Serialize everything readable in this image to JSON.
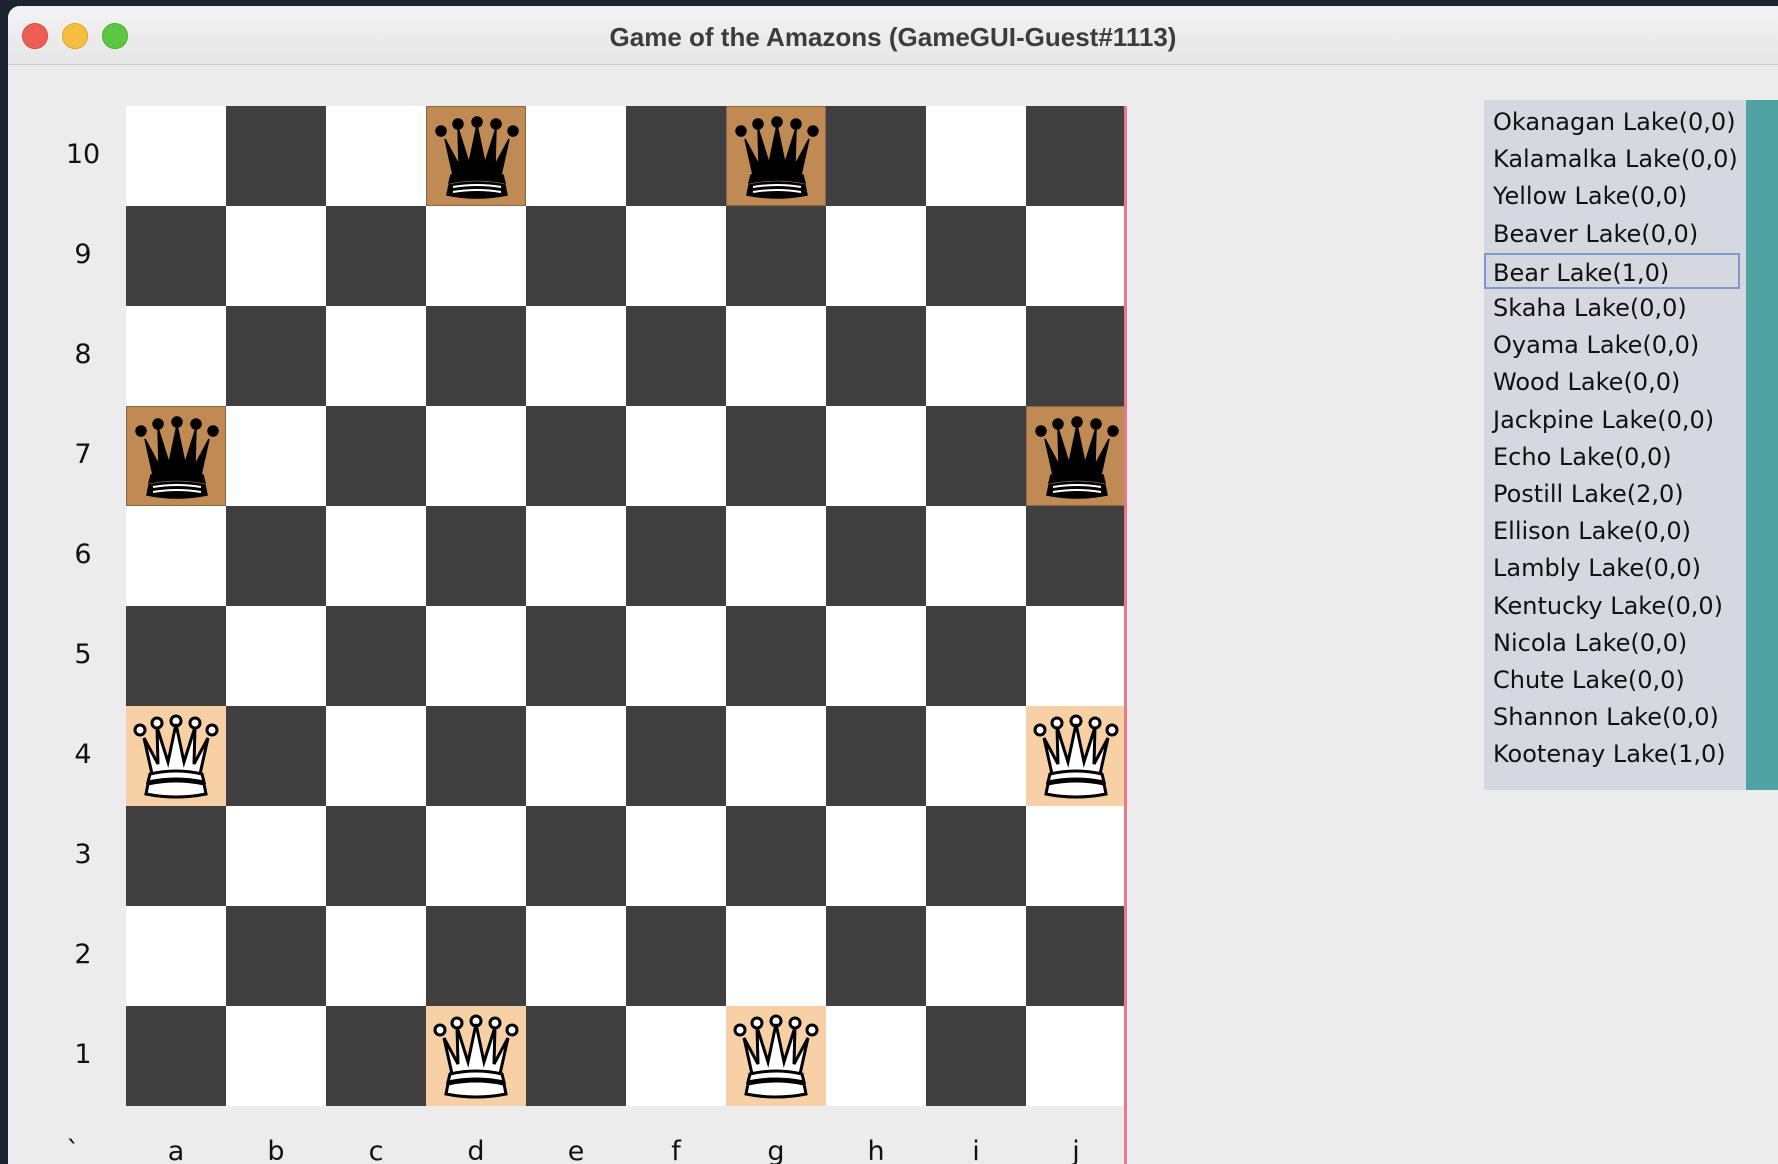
{
  "window": {
    "title": "Game of the Amazons (GameGUI-Guest#1113)"
  },
  "colors": {
    "light_square": "#ffffff",
    "dark_square": "#404040",
    "black_queen_square": "#c08a55",
    "white_queen_square": "#f7d0a5",
    "board_edge": "#e8788e",
    "list_bg": "#d5d8de",
    "scrollbar": "#4fa3a3"
  },
  "board": {
    "size": 10,
    "ranks": [
      "10",
      "9",
      "8",
      "7",
      "6",
      "5",
      "4",
      "3",
      "2",
      "1"
    ],
    "files": [
      "`",
      "a",
      "b",
      "c",
      "d",
      "e",
      "f",
      "g",
      "h",
      "i",
      "j"
    ],
    "pieces": [
      {
        "color": "black",
        "icon": "black-queen-icon",
        "square": "d10"
      },
      {
        "color": "black",
        "icon": "black-queen-icon",
        "square": "g10"
      },
      {
        "color": "black",
        "icon": "black-queen-icon",
        "square": "a7"
      },
      {
        "color": "black",
        "icon": "black-queen-icon",
        "square": "j7"
      },
      {
        "color": "white",
        "icon": "white-queen-icon",
        "square": "a4"
      },
      {
        "color": "white",
        "icon": "white-queen-icon",
        "square": "j4"
      },
      {
        "color": "white",
        "icon": "white-queen-icon",
        "square": "d1"
      },
      {
        "color": "white",
        "icon": "white-queen-icon",
        "square": "g1"
      }
    ]
  },
  "players": {
    "selected_index": 4,
    "items": [
      "Okanagan Lake(0,0)",
      "Kalamalka Lake(0,0)",
      "Yellow Lake(0,0)",
      "Beaver Lake(0,0)",
      "Bear Lake(1,0)",
      "Skaha Lake(0,0)",
      "Oyama Lake(0,0)",
      "Wood Lake(0,0)",
      "Jackpine Lake(0,0)",
      "Echo Lake(0,0)",
      "Postill Lake(2,0)",
      "Ellison Lake(0,0)",
      "Lambly Lake(0,0)",
      "Kentucky Lake(0,0)",
      "Nicola Lake(0,0)",
      "Chute Lake(0,0)",
      "Shannon Lake(0,0)",
      "Kootenay Lake(1,0)"
    ]
  }
}
